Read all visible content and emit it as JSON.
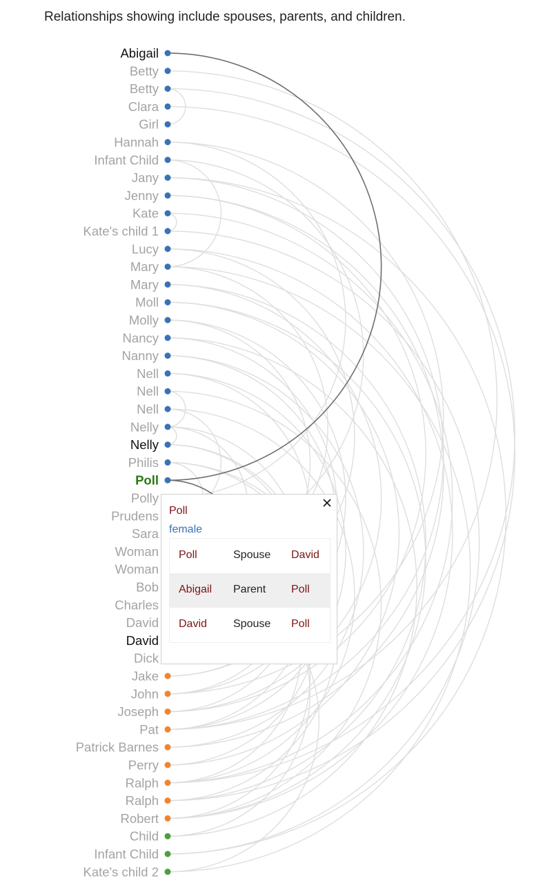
{
  "caption": "Relationships showing include spouses, parents, and children.",
  "colors": {
    "female": "#3a72b4",
    "male": "#f0852d",
    "unknown": "#4f9f3f",
    "selected": "#2a7a12",
    "label_dim": "#a3a3a3",
    "label_active": "#111111",
    "arc_dim": "#dedede",
    "arc_active": "#6e6e6e"
  },
  "people": [
    {
      "name": "Abigail",
      "group": "female"
    },
    {
      "name": "Betty",
      "group": "female"
    },
    {
      "name": "Betty",
      "group": "female"
    },
    {
      "name": "Clara",
      "group": "female"
    },
    {
      "name": "Girl",
      "group": "female"
    },
    {
      "name": "Hannah",
      "group": "female"
    },
    {
      "name": "Infant Child",
      "group": "female"
    },
    {
      "name": "Jany",
      "group": "female"
    },
    {
      "name": "Jenny",
      "group": "female"
    },
    {
      "name": "Kate",
      "group": "female"
    },
    {
      "name": "Kate's child 1",
      "group": "female"
    },
    {
      "name": "Lucy",
      "group": "female"
    },
    {
      "name": "Mary",
      "group": "female"
    },
    {
      "name": "Mary",
      "group": "female"
    },
    {
      "name": "Moll",
      "group": "female"
    },
    {
      "name": "Molly",
      "group": "female"
    },
    {
      "name": "Nancy",
      "group": "female"
    },
    {
      "name": "Nanny",
      "group": "female"
    },
    {
      "name": "Nell",
      "group": "female"
    },
    {
      "name": "Nell",
      "group": "female"
    },
    {
      "name": "Nell",
      "group": "female"
    },
    {
      "name": "Nelly",
      "group": "female"
    },
    {
      "name": "Nelly",
      "group": "female"
    },
    {
      "name": "Philis",
      "group": "female"
    },
    {
      "name": "Poll",
      "group": "female"
    },
    {
      "name": "Polly",
      "group": "female"
    },
    {
      "name": "Prudens",
      "group": "female"
    },
    {
      "name": "Sara",
      "group": "female"
    },
    {
      "name": "Woman",
      "group": "female"
    },
    {
      "name": "Woman",
      "group": "female"
    },
    {
      "name": "Bob",
      "group": "male"
    },
    {
      "name": "Charles",
      "group": "male"
    },
    {
      "name": "David",
      "group": "male"
    },
    {
      "name": "David",
      "group": "male"
    },
    {
      "name": "Dick",
      "group": "male"
    },
    {
      "name": "Jake",
      "group": "male"
    },
    {
      "name": "John",
      "group": "male"
    },
    {
      "name": "Joseph",
      "group": "male"
    },
    {
      "name": "Pat",
      "group": "male"
    },
    {
      "name": "Patrick Barnes",
      "group": "male"
    },
    {
      "name": "Perry",
      "group": "male"
    },
    {
      "name": "Ralph",
      "group": "male"
    },
    {
      "name": "Ralph",
      "group": "male"
    },
    {
      "name": "Robert",
      "group": "male"
    },
    {
      "name": "Child",
      "group": "unknown"
    },
    {
      "name": "Infant Child",
      "group": "unknown"
    },
    {
      "name": "Kate's child 2",
      "group": "unknown"
    }
  ],
  "selected_index": 24,
  "highlighted_indices": [
    0,
    22,
    33
  ],
  "faded_indices": [
    25,
    26,
    27,
    28,
    29,
    30,
    31,
    32,
    33,
    34
  ],
  "links": [
    [
      0,
      24
    ],
    [
      24,
      33
    ],
    [
      2,
      4
    ],
    [
      9,
      10
    ],
    [
      19,
      21
    ],
    [
      6,
      12
    ],
    [
      5,
      25
    ],
    [
      5,
      36
    ],
    [
      7,
      38
    ],
    [
      7,
      45
    ],
    [
      12,
      30
    ],
    [
      15,
      35
    ],
    [
      1,
      38
    ],
    [
      2,
      41
    ],
    [
      3,
      42
    ],
    [
      8,
      39
    ],
    [
      11,
      43
    ],
    [
      13,
      37
    ],
    [
      14,
      40
    ],
    [
      16,
      44
    ],
    [
      17,
      36
    ],
    [
      18,
      38
    ],
    [
      20,
      41
    ],
    [
      21,
      30
    ],
    [
      23,
      42
    ],
    [
      26,
      41
    ],
    [
      27,
      43
    ],
    [
      28,
      44
    ],
    [
      29,
      46
    ],
    [
      12,
      46
    ],
    [
      15,
      31
    ],
    [
      21,
      36
    ],
    [
      22,
      38
    ],
    [
      23,
      40
    ],
    [
      10,
      45
    ],
    [
      17,
      39
    ],
    [
      8,
      37
    ],
    [
      11,
      32
    ],
    [
      13,
      42
    ],
    [
      14,
      43
    ],
    [
      16,
      35
    ],
    [
      18,
      34
    ],
    [
      19,
      43
    ],
    [
      20,
      26
    ],
    [
      21,
      22
    ],
    [
      22,
      37
    ],
    [
      23,
      27
    ],
    [
      6,
      28
    ],
    [
      9,
      41
    ]
  ],
  "popup": {
    "name": "Poll",
    "gender": "female",
    "relations": [
      {
        "from": "Poll",
        "type": "Spouse",
        "to": "David"
      },
      {
        "from": "Abigail",
        "type": "Parent",
        "to": "Poll"
      },
      {
        "from": "David",
        "type": "Spouse",
        "to": "Poll"
      }
    ]
  }
}
